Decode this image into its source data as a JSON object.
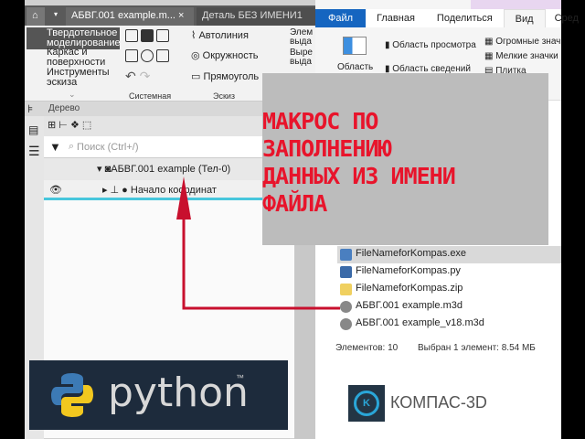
{
  "kompas": {
    "tabs": [
      "АБВГ.001 example.m...",
      "Деталь БЕЗ ИМЕНИ1"
    ],
    "tab_close": "×",
    "modes": [
      "Твердотельное моделирование",
      "Каркас и поверхности",
      "Инструменты эскиза"
    ],
    "sketch_tools": [
      "Автолиния",
      "Окружность",
      "Прямоуголь"
    ],
    "ops": [
      "Элем выда",
      "Выре выда"
    ],
    "groups": [
      "Системная",
      "Эскиз"
    ],
    "tree_title": "Дерево",
    "search_placeholder": "Поиск (Ctrl+/)",
    "tree_items": [
      "АБВГ.001 example (Тел-0)",
      "Начало координат"
    ]
  },
  "explorer": {
    "tabs": [
      "Файл",
      "Главная",
      "Поделиться",
      "Вид",
      "Сред"
    ],
    "pane_button": "Область",
    "pane_options": [
      "Область просмотра",
      "Область сведений"
    ],
    "view_options": [
      "Огромные знач",
      "Мелкие значки",
      "Плитка"
    ],
    "files": [
      "FileNameforKompas.exe",
      "FileNameforKompas.py",
      "FileNameforKompas.zip",
      "АБВГ.001 example.m3d",
      "АБВГ.001 example_v18.m3d"
    ],
    "status_count": "Элементов: 10",
    "status_selected": "Выбран 1 элемент: 8.54 МБ"
  },
  "annotation": [
    "МАКРОС ПО",
    "ЗАПОЛНЕНИЮ",
    "ДАННЫХ ИЗ ИМЕНИ",
    "ФАЙЛА"
  ],
  "logos": {
    "python": "python",
    "python_tm": "™",
    "kompas": "КОМПАС-3D"
  },
  "colors": {
    "annotation": "#e8142b",
    "explorer_file_tab": "#1565c0",
    "arrow": "#c8102e"
  }
}
